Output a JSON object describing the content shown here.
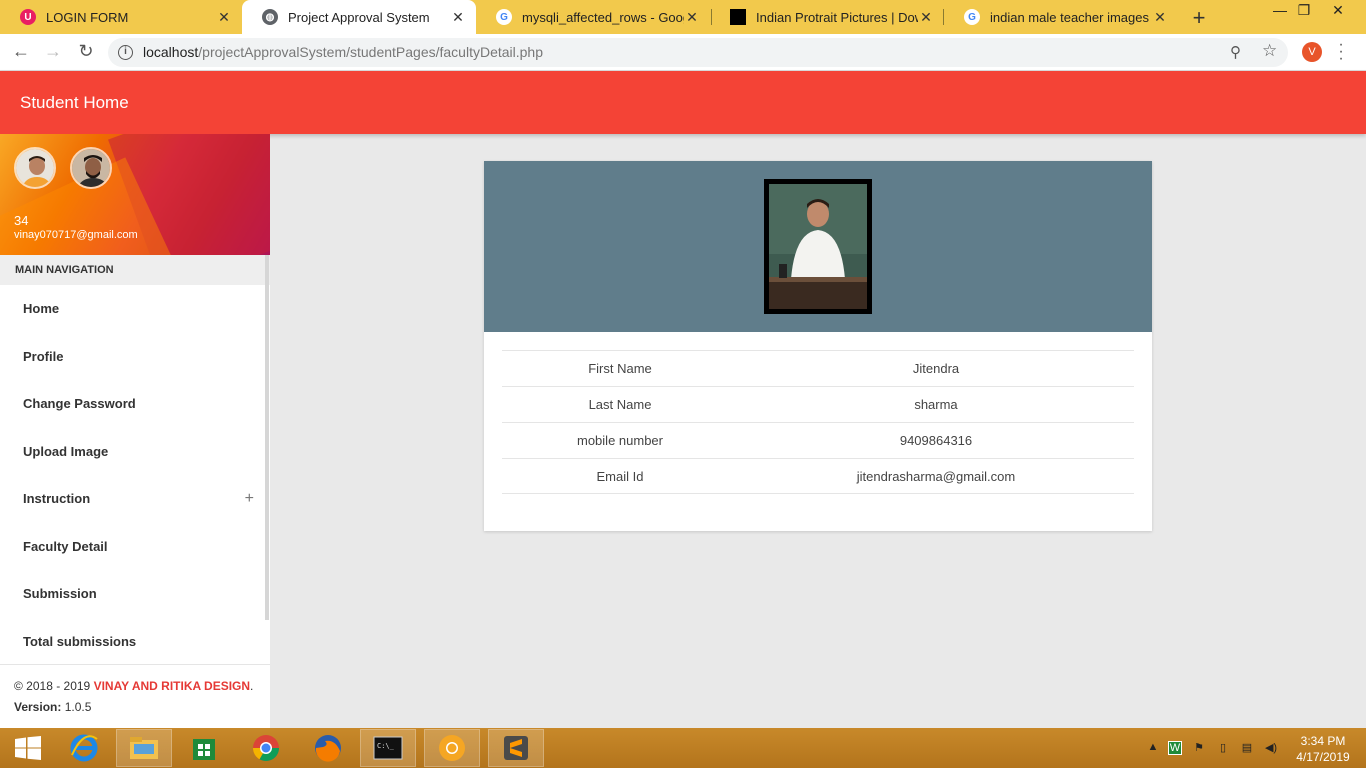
{
  "browser": {
    "tabs": [
      {
        "title": "LOGIN FORM",
        "favicon": "app-favicon"
      },
      {
        "title": "Project Approval System",
        "favicon": "globe-icon",
        "active": true
      },
      {
        "title": "mysqli_affected_rows - Google Search",
        "favicon": "google-icon"
      },
      {
        "title": "Indian Protrait Pictures | Download Free Images",
        "favicon": "unsplash-icon"
      },
      {
        "title": "indian male teacher images - Google Search",
        "favicon": "google-icon"
      }
    ],
    "url_host": "localhost",
    "url_path": "/projectApprovalSystem/studentPages/facultyDetail.php",
    "profile_initial": "V",
    "new_tab": "+"
  },
  "app": {
    "brand": "Student Home",
    "accent": "#f44336"
  },
  "user": {
    "name": "34",
    "email": "vinay070717@gmail.com"
  },
  "nav": {
    "header": "MAIN NAVIGATION",
    "items": [
      {
        "label": "Home"
      },
      {
        "label": "Profile"
      },
      {
        "label": "Change Password"
      },
      {
        "label": "Upload Image"
      },
      {
        "label": "Instruction",
        "expand": "+"
      },
      {
        "label": "Faculty Detail"
      },
      {
        "label": "Submission"
      },
      {
        "label": "Total submissions"
      }
    ]
  },
  "legal": {
    "copyright": "© 2018 - 2019 ",
    "brand": "VINAY AND RITIKA DESIGN",
    "dot": ".",
    "version_label": "Version:",
    "version": " 1.0.5"
  },
  "faculty": {
    "rows": [
      {
        "label": "First Name",
        "value": "Jitendra"
      },
      {
        "label": "Last Name",
        "value": "sharma"
      },
      {
        "label": "mobile number",
        "value": "9409864316"
      },
      {
        "label": "Email Id",
        "value": "jitendrasharma@gmail.com"
      }
    ]
  },
  "taskbar": {
    "time": "3:34 PM",
    "date": "4/17/2019"
  }
}
